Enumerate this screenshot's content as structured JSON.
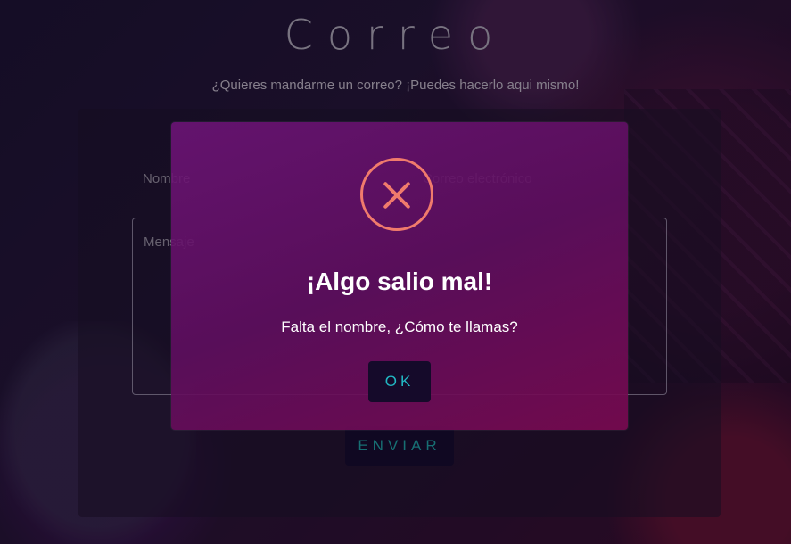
{
  "page": {
    "title": "Correo",
    "subtitle": "¿Quieres mandarme un correo? ¡Puedes hacerlo aqui mismo!"
  },
  "form": {
    "name_placeholder": "Nombre",
    "email_placeholder": "Correo electrónico",
    "message_placeholder": "Mensaje",
    "send_label": "ENVIAR"
  },
  "modal": {
    "icon": "error-x-icon",
    "title": "¡Algo salio mal!",
    "message": "Falta el nombre, ¿Cómo te llamas?",
    "ok_label": "OK"
  },
  "colors": {
    "accent": "#1fa8a6",
    "error": "#f07b6c",
    "modal_bg": "#6e1478",
    "button_bg": "#150a2a"
  }
}
